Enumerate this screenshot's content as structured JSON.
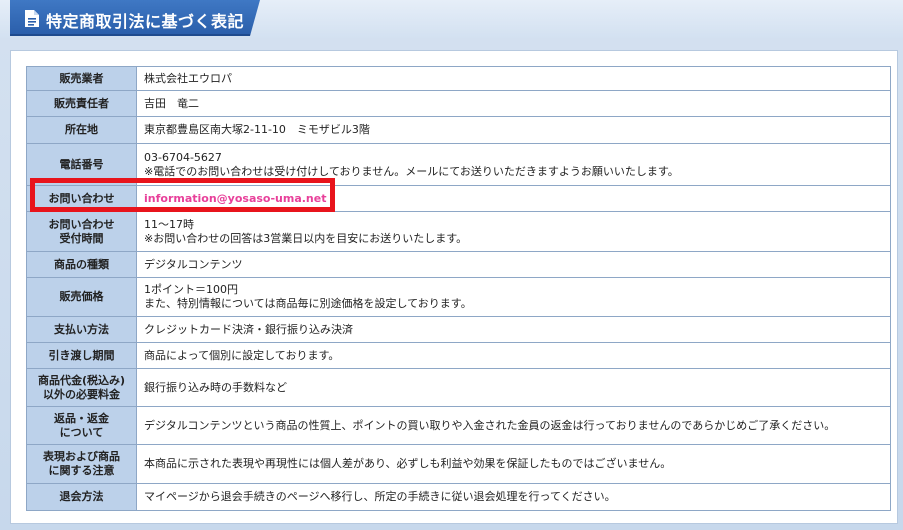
{
  "header": {
    "title": "特定商取引法に基づく表記",
    "icon": "document-icon"
  },
  "colors": {
    "accent": "#2b5fab",
    "label_bg": "#bcd1ea",
    "email": "#e8409a",
    "highlight": "#e8141c"
  },
  "rows": [
    {
      "label": "販売業者",
      "value": "株式会社エウロパ"
    },
    {
      "label": "販売責任者",
      "value": "吉田　竜二"
    },
    {
      "label": "所在地",
      "value": "東京都豊島区南大塚2-11-10　ミモザビル3階"
    },
    {
      "label": "電話番号",
      "line1": "03-6704-5627",
      "line2": "※電話でのお問い合わせは受け付けしておりません。メールにてお送りいただきますようお願いいたします。"
    },
    {
      "label": "お問い合わせ",
      "value": "information@yosaso-uma.net"
    },
    {
      "label_line1": "お問い合わせ",
      "label_line2": "受付時間",
      "line1": "11〜17時",
      "line2": "※お問い合わせの回答は3営業日以内を目安にお送りいたします。"
    },
    {
      "label": "商品の種類",
      "value": "デジタルコンテンツ"
    },
    {
      "label": "販売価格",
      "line1": "1ポイント＝100円",
      "line2": "また、特別情報については商品毎に別途価格を設定しております。"
    },
    {
      "label": "支払い方法",
      "value": "クレジットカード決済・銀行振り込み決済"
    },
    {
      "label": "引き渡し期間",
      "value": "商品によって個別に設定しております。"
    },
    {
      "label_line1": "商品代金(税込み)",
      "label_line2": "以外の必要料金",
      "value": "銀行振り込み時の手数料など"
    },
    {
      "label_line1": "返品・返金",
      "label_line2": "について",
      "value": "デジタルコンテンツという商品の性質上、ポイントの買い取りや入金された金員の返金は行っておりませんのであらかじめご了承ください。"
    },
    {
      "label_line1": "表現および商品",
      "label_line2": "に関する注意",
      "value": "本商品に示された表現や再現性には個人差があり、必ずしも利益や効果を保証したものではございません。"
    },
    {
      "label": "退会方法",
      "value": "マイページから退会手続きのページへ移行し、所定の手続きに従い退会処理を行ってください。"
    }
  ]
}
